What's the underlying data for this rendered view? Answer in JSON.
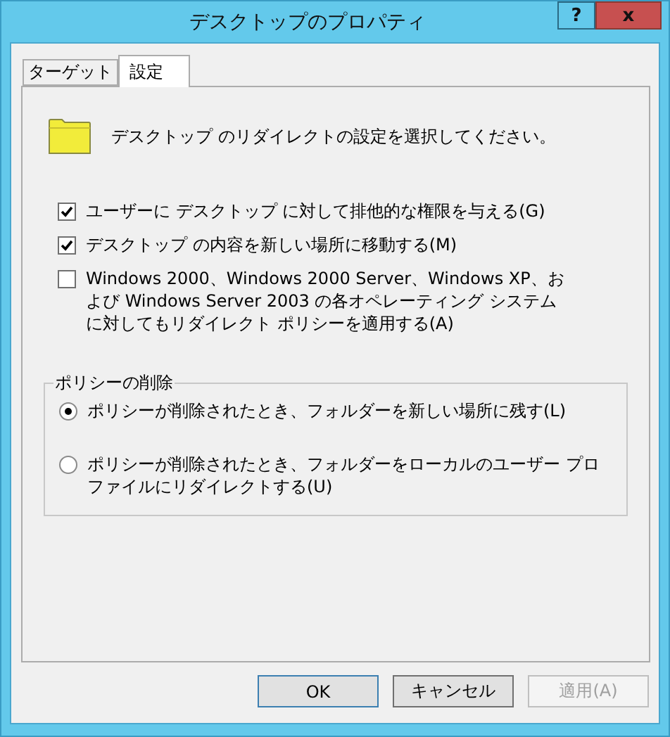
{
  "window": {
    "title": "デスクトップのプロパティ",
    "help": "?",
    "close": "x"
  },
  "tabs": [
    {
      "label": "ターゲット",
      "selected": false
    },
    {
      "label": "設定",
      "selected": true
    }
  ],
  "header": {
    "text": "デスクトップ のリダイレクトの設定を選択してください。"
  },
  "options": [
    {
      "label": "ユーザーに デスクトップ に対して排他的な権限を与える(G)",
      "checked": true
    },
    {
      "label": "デスクトップ の内容を新しい場所に移動する(M)",
      "checked": true
    },
    {
      "label": "Windows 2000、Windows 2000 Server、Windows XP、および Windows Server 2003 の各オペレーティング システムに対してもリダイレクト ポリシーを適用する(A)",
      "checked": false
    }
  ],
  "policy_removal": {
    "title": "ポリシーの削除",
    "choices": [
      {
        "label": "ポリシーが削除されたとき、フォルダーを新しい場所に残す(L)",
        "selected": true
      },
      {
        "label": "ポリシーが削除されたとき、フォルダーをローカルのユーザー プロファイルにリダイレクトする(U)",
        "selected": false
      }
    ]
  },
  "buttons": [
    {
      "label": "OK",
      "kind": "default",
      "disabled": false
    },
    {
      "label": "キャンセル",
      "kind": "normal",
      "disabled": false
    },
    {
      "label": "適用(A)",
      "kind": "normal",
      "disabled": true
    }
  ]
}
